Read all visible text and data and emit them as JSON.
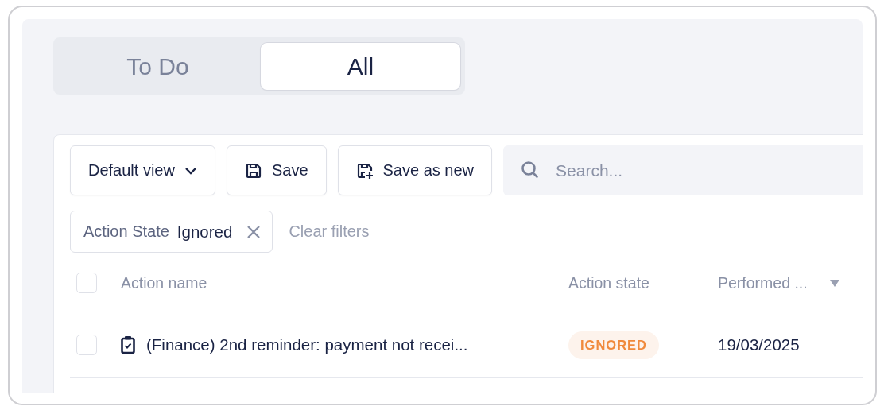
{
  "tabs": [
    {
      "label": "To Do",
      "selected": false
    },
    {
      "label": "All",
      "selected": true
    }
  ],
  "toolbar": {
    "view_menu": "Default view",
    "buttons": [
      {
        "label": "Save",
        "kind": "save"
      },
      {
        "label": "Save as new",
        "kind": "save-new"
      }
    ],
    "search": {
      "placeholder": "Search..."
    }
  },
  "filters": {
    "chips": [
      {
        "field": "Action State",
        "value": "Ignored"
      }
    ],
    "clear": "Clear filters"
  },
  "table": {
    "select_all": {
      "checked": false
    },
    "columns": [
      {
        "label": "Action name"
      },
      {
        "label": "Action state"
      },
      {
        "label": "Performed ...",
        "sorted": true
      }
    ],
    "rows": [
      {
        "checked": false,
        "name": "(Finance) 2nd reminder: payment not recei...",
        "state": "IGNORED",
        "performed": "19/03/2025"
      }
    ]
  }
}
